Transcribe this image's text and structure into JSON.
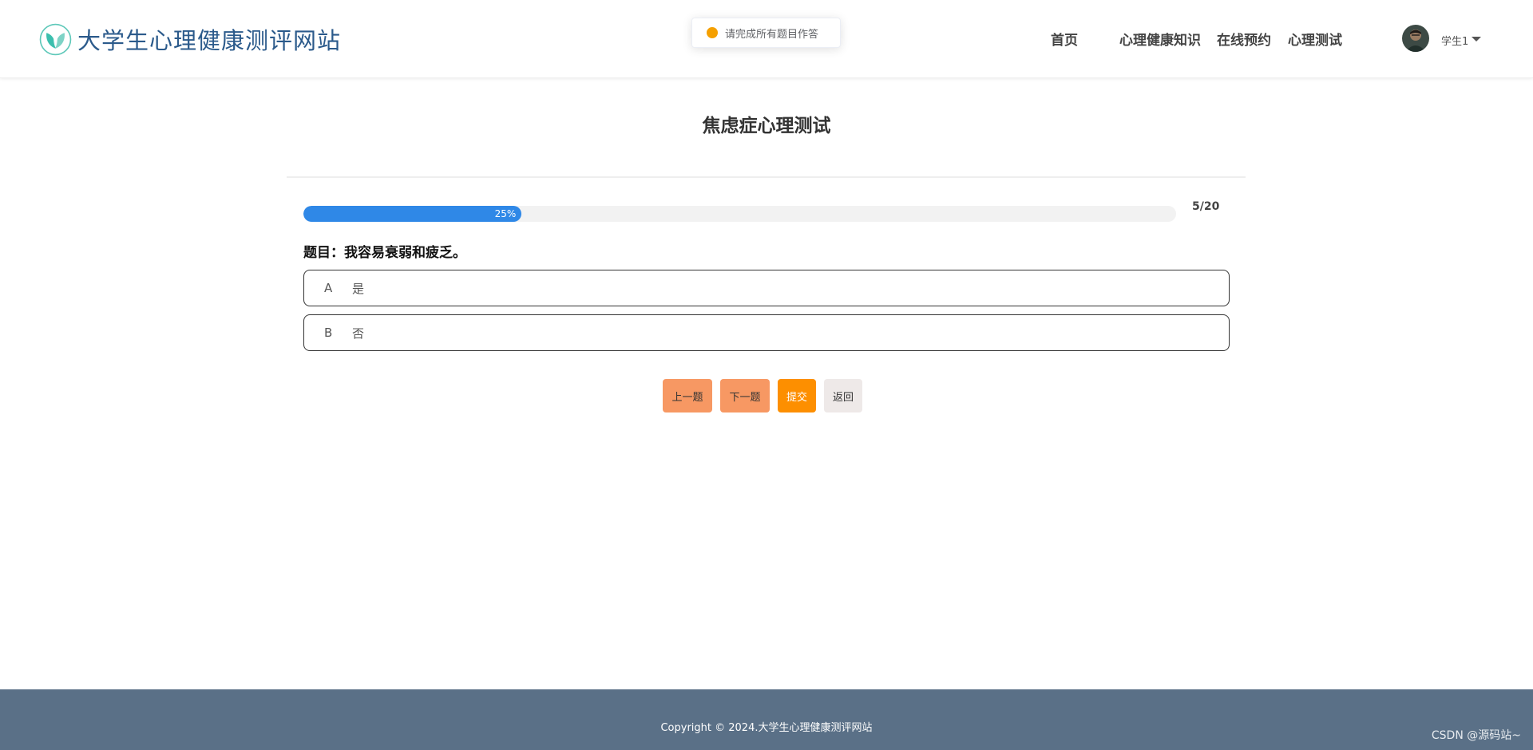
{
  "header": {
    "site_title": "大学生心理健康测评网站",
    "logo_icon": "leaf-circle-icon",
    "brand_color": "#2b5a8b",
    "nav": {
      "home": "首页",
      "knowledge": "心理健康知识",
      "booking": "在线预约",
      "test": "心理测试"
    },
    "user": {
      "name": "学生1",
      "avatar_icon": "user-avatar-icon"
    }
  },
  "toast": {
    "message": "请完成所有题目作答",
    "icon": "warning-dot-icon",
    "color": "#f5a000"
  },
  "test": {
    "title": "焦虑症心理测试",
    "progress": {
      "percent": 25,
      "percent_label": "25%",
      "count_label": "5/20"
    },
    "question": "题目：我容易衰弱和疲乏。",
    "options": [
      {
        "letter": "A",
        "text": "是"
      },
      {
        "letter": "B",
        "text": "否"
      }
    ]
  },
  "buttons": {
    "prev": "上一题",
    "next": "下一题",
    "submit": "提交",
    "back": "返回"
  },
  "footer": {
    "copyright": "Copyright © 2024.大学生心理健康测评网站",
    "watermark": "CSDN @源码站~"
  },
  "colors": {
    "progress": "#2f88e7",
    "nav_button": "#f79863",
    "submit_button": "#fd8f00",
    "back_button": "#eee9e8",
    "footer": "#5a7087"
  }
}
